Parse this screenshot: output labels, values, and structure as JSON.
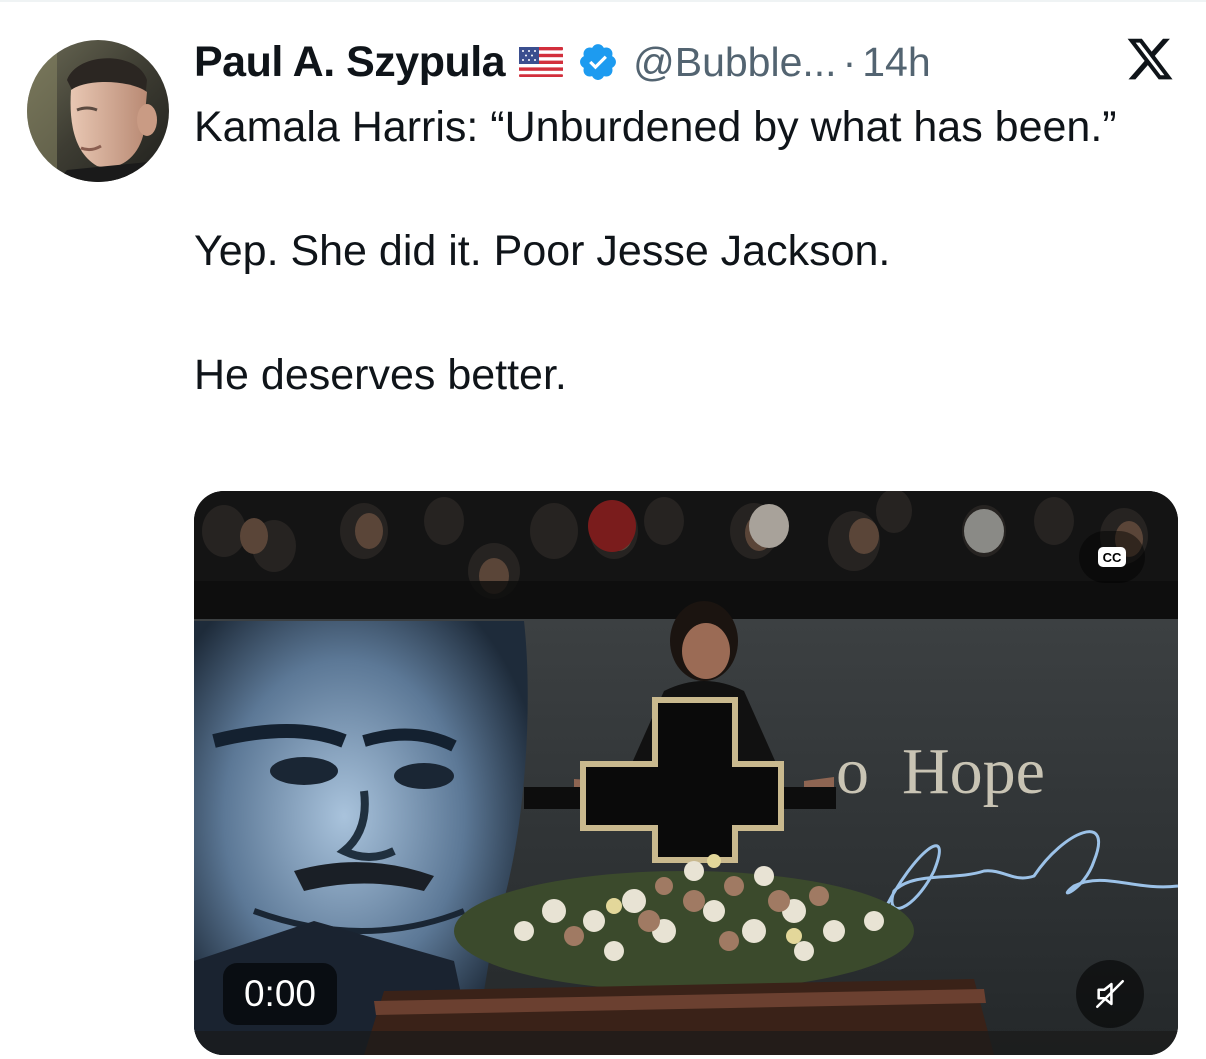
{
  "author": {
    "display_name": "Paul A. Szypula",
    "handle": "@Bubble...",
    "separator": "·",
    "timestamp": "14h",
    "flag_icon": "us-flag-icon",
    "verified_icon": "verified-badge-icon",
    "verified_color": "#1d9bf0"
  },
  "platform_logo": "x-logo-icon",
  "tweet": {
    "lines": [
      "Kamala Harris: “Unburdened by what has been.”",
      "Yep. She did it. Poor Jesse Jackson.",
      "He deserves better."
    ]
  },
  "media": {
    "type": "video",
    "current_time": "0:00",
    "cc_label": "CC",
    "mute_icon": "speaker-muted-icon",
    "scene": {
      "backdrop_text": "Hope",
      "backdrop_partial_left": "o"
    }
  },
  "colors": {
    "text_primary": "#0f1419",
    "text_secondary": "#536471",
    "accent": "#1d9bf0"
  }
}
